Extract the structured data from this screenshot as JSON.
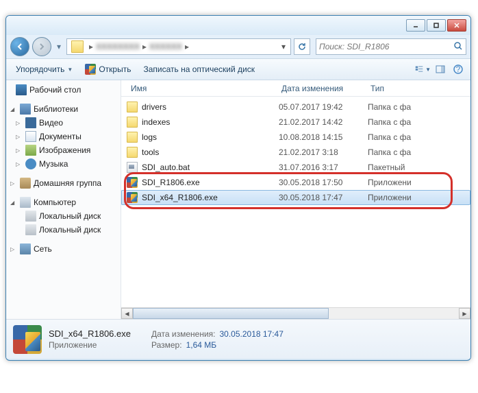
{
  "titlebar": {
    "min": "",
    "max": "",
    "close": ""
  },
  "search": {
    "placeholder": "Поиск: SDI_R1806"
  },
  "toolbar": {
    "organize": "Упорядочить",
    "open": "Открыть",
    "burn": "Записать на оптический диск"
  },
  "nav": {
    "desktop": "Рабочий стол",
    "libraries": "Библиотеки",
    "video": "Видео",
    "documents": "Документы",
    "images": "Изображения",
    "music": "Музыка",
    "homegroup": "Домашняя группа",
    "computer": "Компьютер",
    "drive1": "Локальный диск",
    "drive2": "Локальный диск",
    "network": "Сеть"
  },
  "columns": {
    "name": "Имя",
    "date": "Дата изменения",
    "type": "Тип"
  },
  "files": [
    {
      "icon": "folder",
      "name": "drivers",
      "date": "05.07.2017 19:42",
      "type": "Папка с фа"
    },
    {
      "icon": "folder",
      "name": "indexes",
      "date": "21.02.2017 14:42",
      "type": "Папка с фа"
    },
    {
      "icon": "folder",
      "name": "logs",
      "date": "10.08.2018 14:15",
      "type": "Папка с фа"
    },
    {
      "icon": "folder",
      "name": "tools",
      "date": "21.02.2017 3:18",
      "type": "Папка с фа"
    },
    {
      "icon": "bat",
      "name": "SDI_auto.bat",
      "date": "31.07.2016 3:17",
      "type": "Пакетный"
    },
    {
      "icon": "exe",
      "name": "SDI_R1806.exe",
      "date": "30.05.2018 17:50",
      "type": "Приложени"
    },
    {
      "icon": "exe",
      "name": "SDI_x64_R1806.exe",
      "date": "30.05.2018 17:47",
      "type": "Приложени"
    }
  ],
  "details": {
    "filename": "SDI_x64_R1806.exe",
    "filetype": "Приложение",
    "date_label": "Дата изменения:",
    "date_value": "30.05.2018 17:47",
    "size_label": "Размер:",
    "size_value": "1,64 МБ"
  }
}
